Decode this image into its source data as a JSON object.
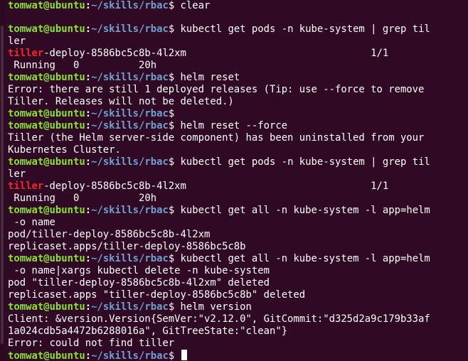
{
  "prompt": {
    "user_host": "tomwat@ubuntu",
    "separator": ":",
    "path": "~/skills/rbac",
    "symbol": "$"
  },
  "lines": {
    "l01": " clear",
    "l02": " kubectl get pods -n kube-system | grep til",
    "l03": "ler",
    "l04_match": "tiller",
    "l04_rest": "-deploy-8586bc5c8b-4l2xm                               1/1",
    "l05": " Running   0          20h",
    "l06": " helm reset",
    "l07": "Error: there are still 1 deployed releases (Tip: use --force to remove",
    "l08": "Tiller. Releases will not be deleted.)",
    "l09": "",
    "l10": " helm reset --force",
    "l11": "Tiller (the Helm server-side component) has been uninstalled from your",
    "l12": "Kubernetes Cluster.",
    "l13": " kubectl get pods -n kube-system | grep til",
    "l14": "ler",
    "l15_match": "tiller",
    "l15_rest": "-deploy-8586bc5c8b-4l2xm                               1/1",
    "l16": " Running   0          20h",
    "l17": " kubectl get all -n kube-system -l app=helm",
    "l18": " -o name",
    "l19": "pod/tiller-deploy-8586bc5c8b-4l2xm",
    "l20": "replicaset.apps/tiller-deploy-8586bc5c8b",
    "l21": " kubectl get all -n kube-system -l app=helm",
    "l22": " -o name|xargs kubectl delete -n kube-system",
    "l23": "pod \"tiller-deploy-8586bc5c8b-4l2xm\" deleted",
    "l24": "replicaset.apps \"tiller-deploy-8586bc5c8b\" deleted",
    "l25": " helm version",
    "l26": "Client: &version.Version{SemVer:\"v2.12.0\", GitCommit:\"d325d2a9c179b33af",
    "l27": "1a024cdb5a4472b6288016a\", GitTreeState:\"clean\"}",
    "l28": "Error: could not find tiller",
    "l29": " "
  },
  "colors": {
    "background": "#300a24",
    "prompt_user": "#8ae234",
    "prompt_path": "#729fcf",
    "grep_match": "#ef2929",
    "text": "#ffffff"
  }
}
